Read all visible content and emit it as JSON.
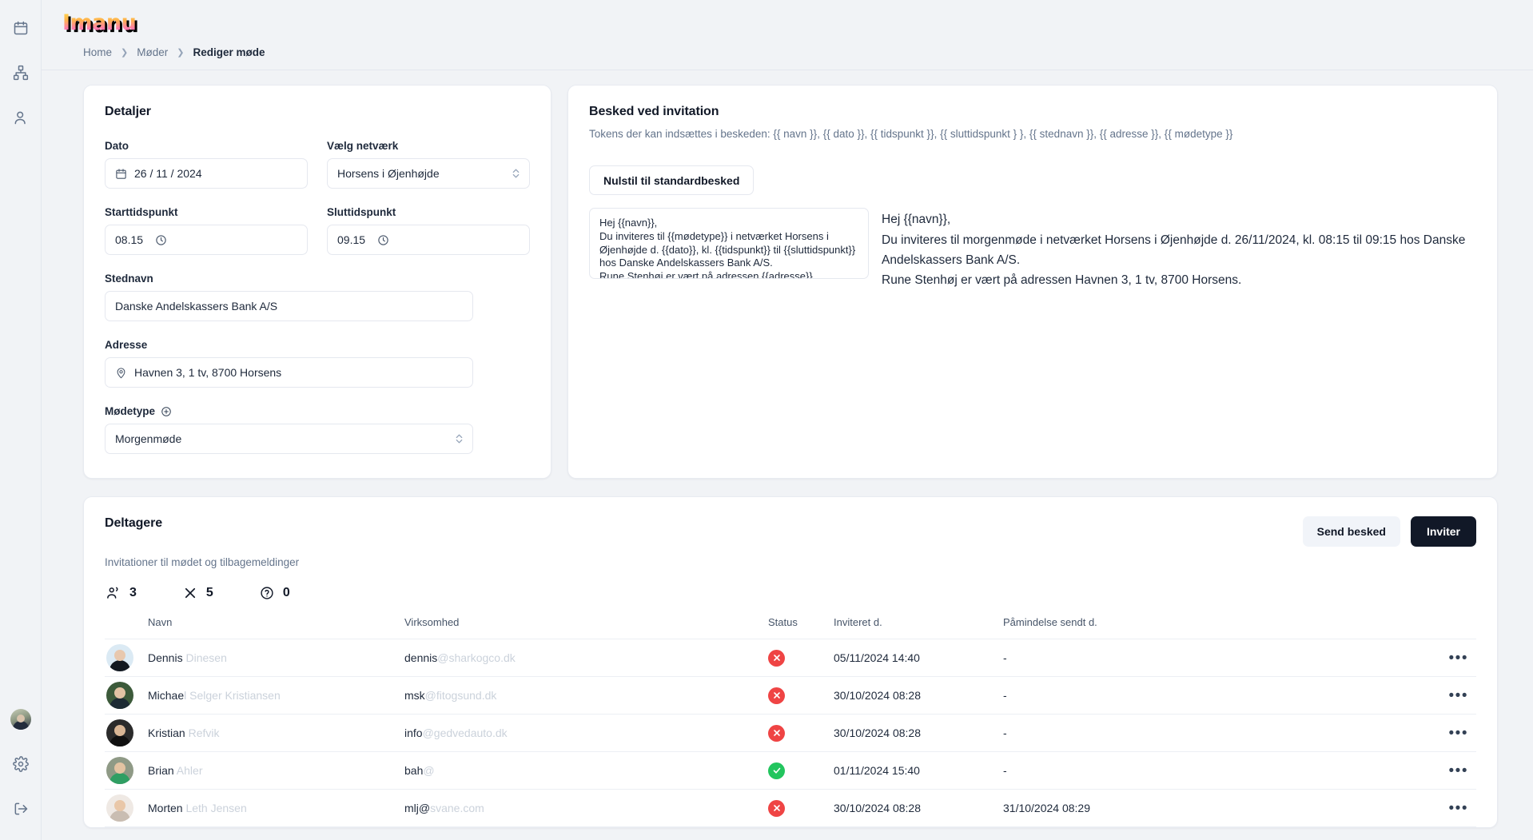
{
  "brand": {
    "logo_text": "Imanu"
  },
  "sidebar": {
    "items": [
      {
        "name": "calendar-icon",
        "label": "Kalender"
      },
      {
        "name": "network-icon",
        "label": "Netværk"
      },
      {
        "name": "users-icon",
        "label": "Brugere"
      }
    ],
    "bottom": [
      {
        "name": "avatar",
        "label": "Profil"
      },
      {
        "name": "gear-icon",
        "label": "Indstillinger"
      },
      {
        "name": "logout-icon",
        "label": "Log ud"
      }
    ]
  },
  "breadcrumb": {
    "home": "Home",
    "section": "Møder",
    "current": "Rediger møde"
  },
  "details": {
    "title": "Detaljer",
    "date_label": "Dato",
    "date_value": "26 / 11 / 2024",
    "network_label": "Vælg netværk",
    "network_value": "Horsens i Øjenhøjde",
    "start_label": "Starttidspunkt",
    "start_value": "08.15",
    "end_label": "Sluttidspunkt",
    "end_value": "09.15",
    "venue_label": "Stednavn",
    "venue_value": "Danske Andelskassers Bank A/S",
    "address_label": "Adresse",
    "address_value": "Havnen 3, 1 tv, 8700 Horsens",
    "meetingtype_label": "Mødetype",
    "meetingtype_value": "Morgenmøde"
  },
  "message": {
    "title": "Besked ved invitation",
    "tokens_hint": "Tokens der kan indsættes i beskeden: {{ navn }}, {{ dato }}, {{ tidspunkt }}, {{ sluttidspunkt } }, {{ stednavn }}, {{ adresse }}, {{ mødetype }}",
    "reset_button": "Nulstil til standardbesked",
    "template": "Hej {{navn}},\nDu inviteres til {{mødetype}} i netværket Horsens i Øjenhøjde d. {{dato}}, kl. {{tidspunkt}} til {{sluttidspunkt}} hos Danske Andelskassers Bank A/S.\nRune Stenhøj er vært på adressen {{adresse}}.",
    "preview": "Hej {{navn}},\nDu inviteres til morgenmøde i netværket Horsens i Øjenhøjde d. 26/11/2024, kl. 08:15 til 09:15 hos Danske Andelskassers Bank A/S.\nRune Stenhøj er vært på adressen Havnen 3, 1 tv, 8700 Horsens."
  },
  "participants": {
    "title": "Deltagere",
    "subtitle": "Invitationer til mødet og tilbagemeldinger",
    "send_message_button": "Send besked",
    "invite_button": "Inviter",
    "stats": [
      {
        "icon": "users-icon",
        "value": "3"
      },
      {
        "icon": "close-icon",
        "value": "5"
      },
      {
        "icon": "question-icon",
        "value": "0"
      }
    ],
    "columns": [
      "Navn",
      "Virksomhed",
      "Status",
      "Inviteret d.",
      "Påmindelse sendt d.",
      ""
    ],
    "rows": [
      {
        "name_visible": "Dennis",
        "name_redacted": " Dinesen",
        "company_visible": "dennis",
        "company_redacted": "@sharkogco.dk",
        "status": "declined",
        "invited": "05/11/2024 14:40",
        "reminder": "-",
        "avatar": "a0"
      },
      {
        "name_visible": "Michae",
        "name_redacted": "l Selger Kristiansen",
        "company_visible": "msk",
        "company_redacted": "@fitogsund.dk",
        "status": "declined",
        "invited": "30/10/2024 08:28",
        "reminder": "-",
        "avatar": "a1"
      },
      {
        "name_visible": "Kristian",
        "name_redacted": " Refvik",
        "company_visible": "info",
        "company_redacted": "@gedvedauto.dk",
        "status": "declined",
        "invited": "30/10/2024 08:28",
        "reminder": "-",
        "avatar": "a2"
      },
      {
        "name_visible": "Brian",
        "name_redacted": " Ahler",
        "company_visible": "bah",
        "company_redacted": "@",
        "status": "accepted",
        "invited": "01/11/2024 15:40",
        "reminder": "-",
        "avatar": "a3"
      },
      {
        "name_visible": "Morten",
        "name_redacted": " Leth Jensen",
        "company_visible": "mlj@",
        "company_redacted": "svane.com",
        "status": "declined",
        "invited": "30/10/2024 08:28",
        "reminder": "31/10/2024 08:29",
        "avatar": "a4"
      }
    ],
    "menu_glyph": "•••"
  },
  "colors": {
    "accent_dark": "#111827",
    "status_declined": "#ef4444",
    "status_accepted": "#22c55e",
    "muted": "#64748b"
  }
}
